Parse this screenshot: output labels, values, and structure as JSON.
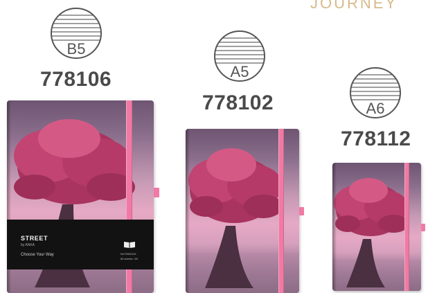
{
  "brand": {
    "text": "JOURNEY"
  },
  "notebooks": [
    {
      "size": "B5",
      "code": "778106"
    },
    {
      "size": "A5",
      "code": "778102"
    },
    {
      "size": "A6",
      "code": "778112"
    }
  ],
  "band": {
    "brand_name": "STREET",
    "sub": "by ANKA",
    "tagline": "Choose Your Way",
    "small_line1": "NOTEBOOK",
    "small_line2": "80 sheets / 80"
  },
  "colors": {
    "elastic": "#f07aa5",
    "accent_text": "#d8b98a",
    "code_text": "#4a4a4a"
  },
  "icons": [
    "lined-circle-icon",
    "open-book-icon"
  ]
}
